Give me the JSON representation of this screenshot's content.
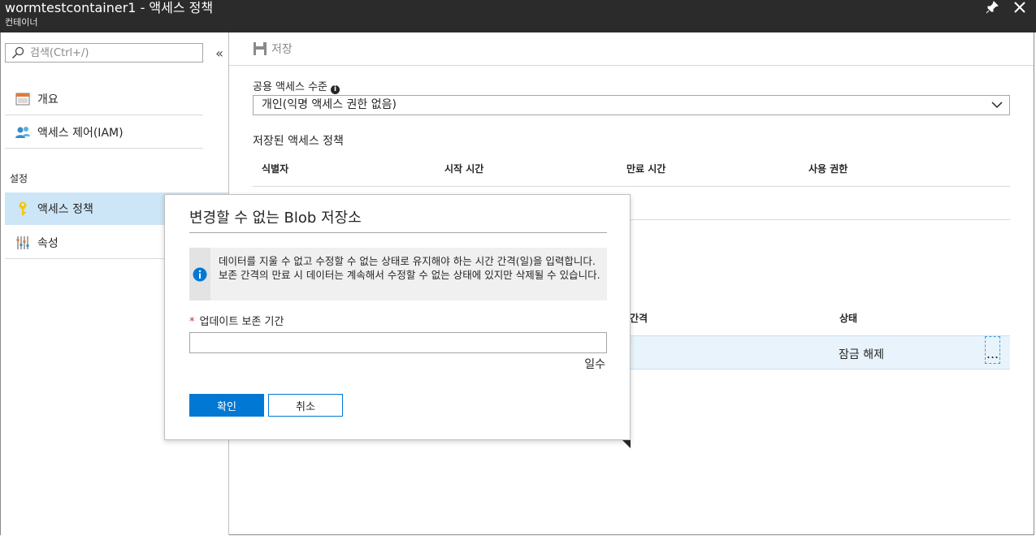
{
  "window": {
    "title": "wormtestcontainer1 - 액세스 정책",
    "subtitle": "컨테이너",
    "pin_icon": "pin-icon",
    "close_icon": "close-icon"
  },
  "sidebar": {
    "search_placeholder": "검색(Ctrl+/)",
    "collapse_glyph": "«",
    "items": [
      {
        "label": "개요",
        "icon": "overview-icon"
      },
      {
        "label": "액세스 제어(IAM)",
        "icon": "iam-icon"
      }
    ],
    "section_label": "설정",
    "settings_items": [
      {
        "label": "액세스 정책",
        "icon": "key-icon",
        "active": true
      },
      {
        "label": "속성",
        "icon": "properties-icon"
      }
    ]
  },
  "toolbar": {
    "save_label": "저장"
  },
  "main": {
    "public_access_label": "공용 액세스 수준",
    "public_access_value": "개인(익명 액세스 권한 없음)",
    "stored_policies_label": "저장된 액세스 정책",
    "columns": [
      "식별자",
      "시작 시간",
      "만료 시간",
      "사용 권한"
    ],
    "immutable_columns": [
      "간격",
      "상태"
    ],
    "immutable_row": {
      "status": "잠금 해제",
      "more": "..."
    }
  },
  "dialog": {
    "title": "변경할 수 없는 Blob 저장소",
    "info_text": "데이터를 지울 수 없고 수정할 수 없는 상태로 유지해야 하는 시간 간격(일)을 입력합니다. 보존 간격의 만료 시 데이터는 계속해서 수정할 수 없는 상태에 있지만 삭제될 수 있습니다.",
    "field_label": "업데이트 보존 기간",
    "field_required": "*",
    "field_value": "",
    "unit": "일수",
    "ok_label": "확인",
    "cancel_label": "취소"
  },
  "colors": {
    "accent": "#0078d4",
    "active_nav": "#cde6f7",
    "titlebar": "#2b2b2b"
  }
}
